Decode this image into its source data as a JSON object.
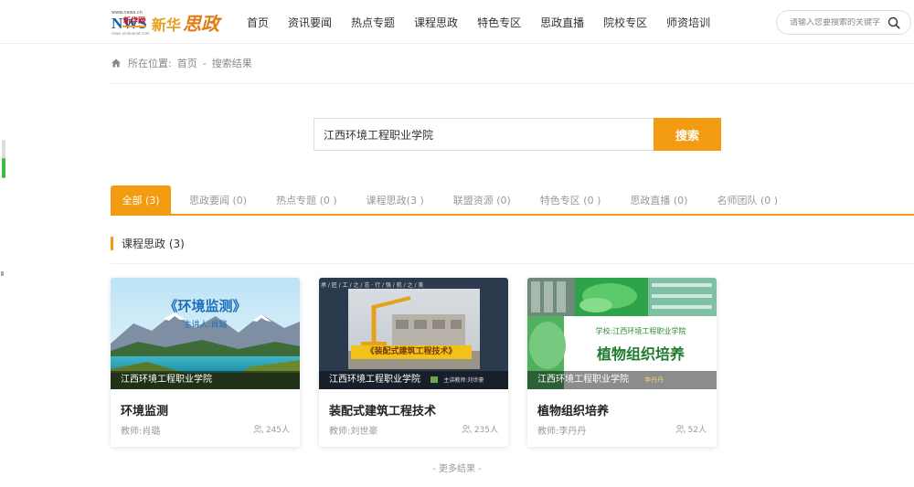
{
  "header": {
    "logo": {
      "news_small": "www.news.cn",
      "news_big": "NWS",
      "xinhua_small": "新华网",
      "url_small": "news.xinhuanet.com",
      "brand_part1": "新华",
      "brand_part2": "思政"
    },
    "nav": [
      {
        "label": "首页"
      },
      {
        "label": "资讯要闻"
      },
      {
        "label": "热点专题"
      },
      {
        "label": "课程思政"
      },
      {
        "label": "特色专区"
      },
      {
        "label": "思政直播"
      },
      {
        "label": "院校专区"
      },
      {
        "label": "师资培训"
      }
    ],
    "search_placeholder": "请输入您要搜索的关键字"
  },
  "breadcrumb": {
    "prefix": "所在位置:",
    "home": "首页",
    "sep": "-",
    "current": "搜索结果"
  },
  "search": {
    "value": "江西环境工程职业学院",
    "button": "搜索"
  },
  "tabs": [
    {
      "label": "全部 (3)"
    },
    {
      "label": "思政要闻 (0)"
    },
    {
      "label": "热点专题 (0 )"
    },
    {
      "label": "课程思政(3 )"
    },
    {
      "label": "联盟资源 (0)"
    },
    {
      "label": "特色专区 (0 )"
    },
    {
      "label": "思政直播 (0)"
    },
    {
      "label": "名师团队 (0 )"
    }
  ],
  "section": {
    "title": "课程思政 (3)"
  },
  "cards": [
    {
      "school": "江西环境工程职业学院",
      "title": "环境监测",
      "teacher": "教师:肖璐",
      "count": "245人",
      "thumb_title": "《环境监测》",
      "thumb_sub": "主讲人:肖璐"
    },
    {
      "school": "江西环境工程职业学院",
      "title": "装配式建筑工程技术",
      "teacher": "教师:刘世豪",
      "count": "235人",
      "thumb_top": "承 / 匠 / 工 / 之 / 志 · 行 / 强 / 航 / 之 / 美",
      "thumb_banner": "《装配式建筑工程技术》",
      "thumb_teacher": "主讲教师:刘世豪"
    },
    {
      "school": "江西环境工程职业学院",
      "title": "植物组织培养",
      "teacher": "教师:李丹丹",
      "count": "52人",
      "thumb_school": "学校:江西环境工程职业学院",
      "thumb_title": "植物组织培养",
      "thumb_teacher": "李丹丹"
    }
  ],
  "more": "- 更多结果 -",
  "colors": {
    "accent": "#f39c12",
    "scroll_green": "#3cb94a"
  }
}
